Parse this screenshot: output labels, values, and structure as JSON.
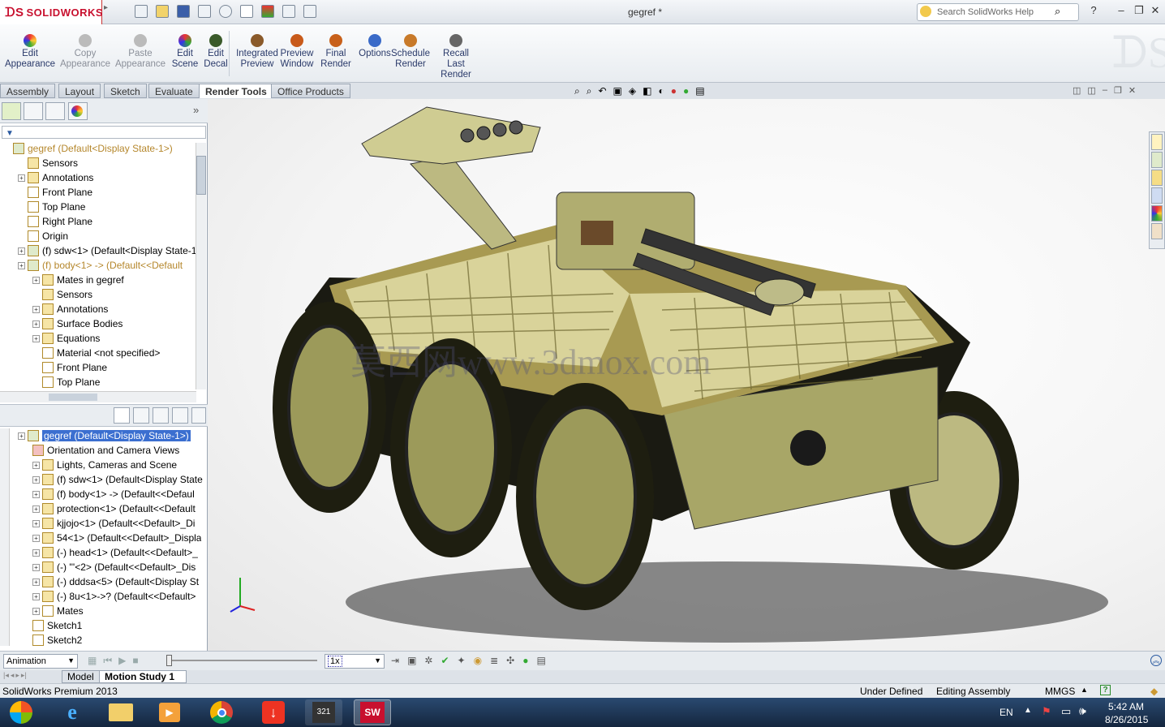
{
  "app": {
    "brand": "SOLIDWORKS",
    "document_title": "gegref *",
    "search_placeholder": "Search SolidWorks Help"
  },
  "ribbon": {
    "buttons": [
      {
        "label": "Edit\nAppearance",
        "icon": "appearance-ball-icon",
        "enabled": true
      },
      {
        "label": "Copy\nAppearance",
        "icon": "copy-appearance-icon",
        "enabled": false
      },
      {
        "label": "Paste\nAppearance",
        "icon": "paste-appearance-icon",
        "enabled": false
      },
      {
        "label": "Edit\nScene",
        "icon": "scene-icon",
        "enabled": true
      },
      {
        "label": "Edit\nDecal",
        "icon": "decal-icon",
        "enabled": true
      },
      {
        "label": "Integrated\nPreview",
        "icon": "integrated-preview-icon",
        "enabled": true
      },
      {
        "label": "Preview\nWindow",
        "icon": "preview-window-icon",
        "enabled": true
      },
      {
        "label": "Final\nRender",
        "icon": "final-render-icon",
        "enabled": true
      },
      {
        "label": "Options",
        "icon": "options-icon",
        "enabled": true
      },
      {
        "label": "Schedule\nRender",
        "icon": "schedule-render-icon",
        "enabled": true
      },
      {
        "label": "Recall\nLast\nRender",
        "icon": "recall-render-icon",
        "enabled": true
      }
    ]
  },
  "tabs": [
    "Assembly",
    "Layout",
    "Sketch",
    "Evaluate",
    "Render Tools",
    "Office Products"
  ],
  "active_tab": "Render Tools",
  "feature_tree": {
    "root": "gegref  (Default<Display State-1>)",
    "items": [
      {
        "label": "Sensors",
        "indent": 1
      },
      {
        "label": "Annotations",
        "indent": 1
      },
      {
        "label": "Front Plane",
        "indent": 1
      },
      {
        "label": "Top Plane",
        "indent": 1
      },
      {
        "label": "Right Plane",
        "indent": 1
      },
      {
        "label": "Origin",
        "indent": 1
      },
      {
        "label": "(f) sdw<1> (Default<Display State-1>",
        "indent": 1
      },
      {
        "label": "(f) body<1> -> (Default<<Default",
        "indent": 1,
        "dim": true
      },
      {
        "label": "Mates in gegref",
        "indent": 2
      },
      {
        "label": "Sensors",
        "indent": 2
      },
      {
        "label": "Annotations",
        "indent": 2
      },
      {
        "label": "Surface Bodies",
        "indent": 2
      },
      {
        "label": "Equations",
        "indent": 2
      },
      {
        "label": "Material <not specified>",
        "indent": 2
      },
      {
        "label": "Front Plane",
        "indent": 2
      },
      {
        "label": "Top Plane",
        "indent": 2
      }
    ]
  },
  "motion_tree": {
    "root": "gegref  (Default<Display State-1>)",
    "items": [
      "Orientation and Camera Views",
      "Lights, Cameras and Scene",
      "(f) sdw<1> (Default<Display State",
      "(f) body<1> -> (Default<<Defaul",
      "protection<1> (Default<<Default",
      "kjjojo<1> (Default<<Default>_Di",
      "54<1> (Default<<Default>_Displa",
      "(-) head<1> (Default<<Default>_",
      "(-) '''<2> (Default<<Default>_Dis",
      "(-) dddsa<5> (Default<Display St",
      "(-) 8u<1>->? (Default<<Default>",
      "Mates",
      "Sketch1",
      "Sketch2"
    ]
  },
  "motion": {
    "study_type": "Animation",
    "scale_field": "1x"
  },
  "bottom_tabs": [
    "Model",
    "Motion Study 1"
  ],
  "status": {
    "product": "SolidWorks Premium 2013",
    "state1": "Under Defined",
    "state2": "Editing Assembly",
    "units": "MMGS"
  },
  "watermark": "莫西网www.3dmox.com",
  "taskbar": {
    "lang": "EN",
    "time": "5:42 AM",
    "date": "8/26/2015"
  },
  "colors": {
    "selection": "#3b6fd0",
    "accent": "#c8102e",
    "model_body": "#9c9a5a",
    "taskbar": "#1c3452"
  }
}
